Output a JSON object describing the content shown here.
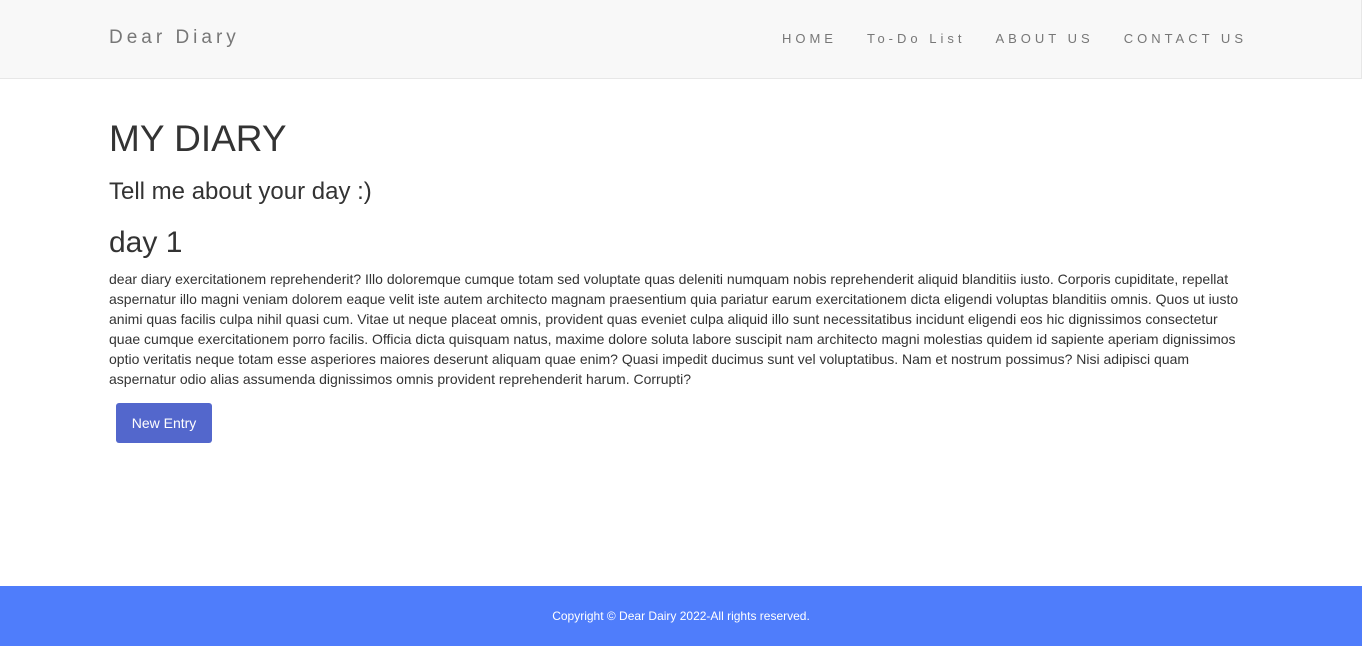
{
  "navbar": {
    "brand": "Dear Diary",
    "links": [
      {
        "label": "HOME"
      },
      {
        "label": "To-Do List"
      },
      {
        "label": "ABOUT US"
      },
      {
        "label": "CONTACT US"
      }
    ]
  },
  "main": {
    "title": "MY DIARY",
    "subtitle": "Tell me about your day :)",
    "entry": {
      "title": "day 1",
      "body": "dear diary exercitationem reprehenderit? Illo doloremque cumque totam sed voluptate quas deleniti numquam nobis reprehenderit aliquid blanditiis iusto. Corporis cupiditate, repellat aspernatur illo magni veniam dolorem eaque velit iste autem architecto magnam praesentium quia pariatur earum exercitationem dicta eligendi voluptas blanditiis omnis. Quos ut iusto animi quas facilis culpa nihil quasi cum. Vitae ut neque placeat omnis, provident quas eveniet culpa aliquid illo sunt necessitatibus incidunt eligendi eos hic dignissimos consectetur quae cumque exercitationem porro facilis. Officia dicta quisquam natus, maxime dolore soluta labore suscipit nam architecto magni molestias quidem id sapiente aperiam dignissimos optio veritatis neque totam esse asperiores maiores deserunt aliquam quae enim? Quasi impedit ducimus sunt vel voluptatibus. Nam et nostrum possimus? Nisi adipisci quam aspernatur odio alias assumenda dignissimos omnis provident reprehenderit harum. Corrupti?"
    },
    "new_entry_label": "New Entry"
  },
  "footer": {
    "copyright": "Copyright © Dear Dairy 2022-All rights reserved."
  },
  "colors": {
    "navbar_bg": "#f8f8f8",
    "button_bg": "#5367cc",
    "footer_bg": "#4f7dfb"
  }
}
